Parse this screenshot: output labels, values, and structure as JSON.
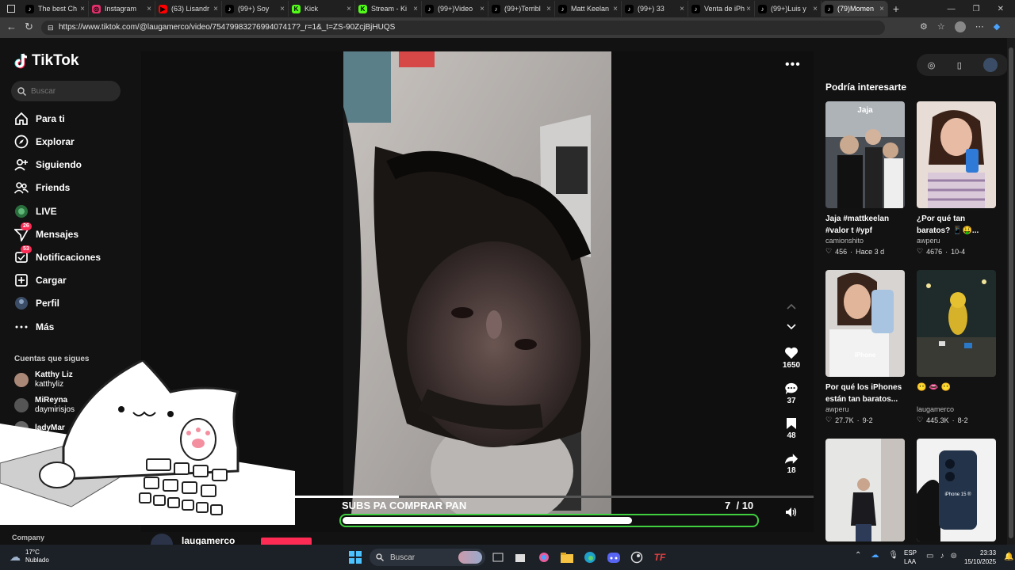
{
  "browser": {
    "tabs": [
      {
        "label": "The best Ch",
        "icon": "tiktok-icon",
        "color": "#ffffff"
      },
      {
        "label": "Instagram",
        "icon": "instagram-icon",
        "color": "#e1306c"
      },
      {
        "label": "(63) Lisandr",
        "icon": "youtube-icon",
        "color": "#ff0000"
      },
      {
        "label": "(99+) Soy",
        "icon": "tiktok-icon",
        "color": "#ffffff"
      },
      {
        "label": "Kick",
        "icon": "kick-icon",
        "color": "#53fc18"
      },
      {
        "label": "Stream - Ki",
        "icon": "kick-icon",
        "color": "#53fc18"
      },
      {
        "label": "(99+)Video",
        "icon": "tiktok-icon",
        "color": "#ffffff"
      },
      {
        "label": "(99+)Terribl",
        "icon": "tiktok-icon",
        "color": "#ffffff"
      },
      {
        "label": "Matt Keelan",
        "icon": "tiktok-icon",
        "color": "#ffffff"
      },
      {
        "label": "(99+) 33",
        "icon": "tiktok-icon",
        "color": "#ffffff"
      },
      {
        "label": "Venta de iPh",
        "icon": "tiktok-icon",
        "color": "#ffffff"
      },
      {
        "label": "(99+)Luis y",
        "icon": "tiktok-icon",
        "color": "#ffffff"
      },
      {
        "label": "(79)Momen",
        "icon": "tiktok-icon",
        "color": "#ffffff",
        "active": true
      }
    ],
    "url": "https://www.tiktok.com/@laugamerco/video/7547998327699407417?_r=1&_t=ZS-90ZcjBjHUQS"
  },
  "nav": {
    "logo": "TikTok",
    "search_placeholder": "Buscar",
    "items": [
      {
        "label": "Para ti",
        "icon": "home-icon"
      },
      {
        "label": "Explorar",
        "icon": "compass-icon"
      },
      {
        "label": "Siguiendo",
        "icon": "following-icon"
      },
      {
        "label": "Friends",
        "icon": "friends-icon"
      },
      {
        "label": "LIVE",
        "icon": "live-icon"
      },
      {
        "label": "Mensajes",
        "icon": "messages-icon",
        "badge": "26"
      },
      {
        "label": "Notificaciones",
        "icon": "notifications-icon",
        "badge": "53"
      },
      {
        "label": "Cargar",
        "icon": "upload-icon"
      },
      {
        "label": "Perfil",
        "icon": "profile-icon"
      },
      {
        "label": "Más",
        "icon": "more-icon"
      }
    ],
    "following_title": "Cuentas que sigues",
    "following": [
      {
        "name": "Katthy Liz",
        "handle": "katthyliz"
      },
      {
        "name": "MiReyna",
        "handle": "daymirisjos"
      },
      {
        "name": "ladyMar",
        "handle": ""
      }
    ],
    "company": "Company"
  },
  "video": {
    "caption": "SUBS PA COMPRAR PAN",
    "counter_current": "7",
    "counter_total": "/ 10",
    "progress_fraction": 0.7,
    "playback_fraction": 0.2,
    "author": "laugamerco",
    "actions": {
      "likes": "1650",
      "comments": "37",
      "saves": "48",
      "shares": "18"
    }
  },
  "sidebar": {
    "title": "Podría interesarte",
    "cards": [
      {
        "title": "Jaja #mattkeelan #valor   t #ypf",
        "author": "camionshito",
        "likes": "456",
        "date": "Hace 3 d",
        "thumb": "group-photo"
      },
      {
        "title": "¿Por qué tan baratos? 📱🤑...",
        "author": "awperu",
        "likes": "4676",
        "date": "10-4",
        "thumb": "woman-phone"
      },
      {
        "title": "Por qué los iPhones están tan baratos...",
        "author": "awperu",
        "likes": "27.7K",
        "date": "9-2",
        "thumb": "woman-iphone"
      },
      {
        "title": "😶 👄 😶",
        "author": "laugamerco",
        "likes": "445.3K",
        "date": "8-2",
        "thumb": "night-mascot"
      },
      {
        "title": "",
        "author": "",
        "likes": "",
        "date": "",
        "thumb": "woman-dancing"
      },
      {
        "title": "",
        "author": "",
        "likes": "",
        "date": "",
        "thumb": "iphone-hand"
      }
    ],
    "card_thumb_texts": {
      "iphone_label": "iPhone",
      "iphone15": "iPhone 15 ®"
    }
  },
  "taskbar": {
    "weather_temp": "17°C",
    "weather_desc": "Nublado",
    "search": "Buscar",
    "lang1": "ESP",
    "lang2": "LAA",
    "time": "23:33",
    "date": "15/10/2025"
  },
  "colors": {
    "accent": "#fe2c55",
    "progress_border": "#3fcf3f",
    "background": "#121212"
  }
}
